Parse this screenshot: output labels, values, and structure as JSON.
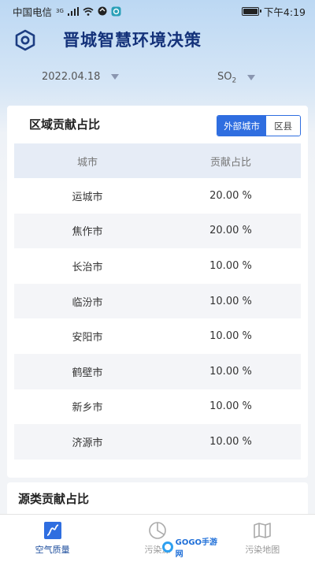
{
  "status_bar": {
    "carrier": "中国电信",
    "network_badge": "3G",
    "time": "下午4:19",
    "icons": [
      "signal-icon",
      "wifi-icon",
      "data-icon",
      "app-notification-icon",
      "battery-icon"
    ]
  },
  "header": {
    "title": "晋城智慧环境决策",
    "menu_icon": "hexagon-settings-icon"
  },
  "filters": {
    "date": "2022.04.18",
    "pollutant_main": "SO",
    "pollutant_sub": "2"
  },
  "region_card": {
    "title": "区域贡献占比",
    "tabs": [
      {
        "label": "外部城市",
        "active": true
      },
      {
        "label": "区县",
        "active": false
      }
    ],
    "columns": [
      "城市",
      "贡献占比"
    ],
    "rows": [
      {
        "city": "运城市",
        "share": "20.00 %"
      },
      {
        "city": "焦作市",
        "share": "20.00 %"
      },
      {
        "city": "长治市",
        "share": "10.00 %"
      },
      {
        "city": "临汾市",
        "share": "10.00 %"
      },
      {
        "city": "安阳市",
        "share": "10.00 %"
      },
      {
        "city": "鹤壁市",
        "share": "10.00 %"
      },
      {
        "city": "新乡市",
        "share": "10.00 %"
      },
      {
        "city": "济源市",
        "share": "10.00 %"
      }
    ]
  },
  "source_card": {
    "title": "源类贡献占比"
  },
  "bottom_nav": {
    "items": [
      {
        "label": "空气质量",
        "icon": "line-chart-icon",
        "active": true
      },
      {
        "label": "污染源",
        "icon": "pie-chart-icon",
        "active": false
      },
      {
        "label": "污染地图",
        "icon": "map-icon",
        "active": false
      }
    ]
  },
  "watermark": {
    "text": "GOGO手游网"
  },
  "colors": {
    "accent": "#2f6ee0",
    "title": "#14327a",
    "nav_active": "#1f4f9e",
    "table_header_bg": "#e6ecf6",
    "alt_row_bg": "#f4f5f8"
  }
}
